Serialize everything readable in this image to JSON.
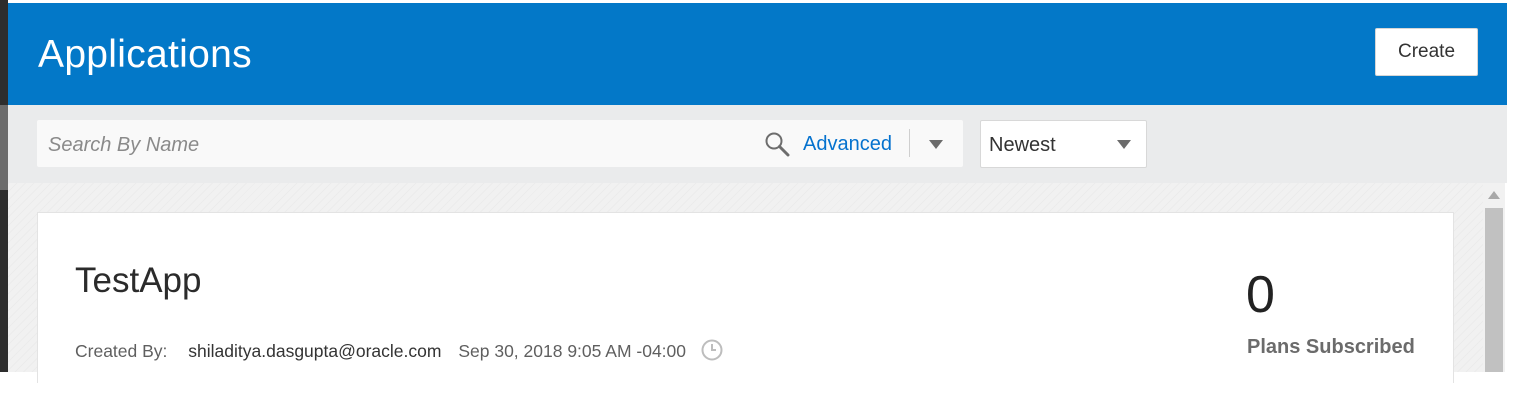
{
  "header": {
    "title": "Applications",
    "create_label": "Create"
  },
  "filter": {
    "search_placeholder": "Search By Name",
    "search_value": "",
    "advanced_label": "Advanced",
    "sort_selected": "Newest"
  },
  "applications": [
    {
      "name": "TestApp",
      "created_by_label": "Created By:",
      "created_by": "shiladitya.dasgupta@oracle.com",
      "created_at": "Sep 30, 2018 9:05 AM -04:00",
      "plans_count": "0",
      "plans_label": "Plans Subscribed"
    }
  ],
  "colors": {
    "header_bg": "#0378c8",
    "link": "#0572ce",
    "filter_bg": "#eaebec"
  },
  "icons": {
    "search": "search-icon",
    "clock": "clock-icon",
    "caret": "chevron-down-icon"
  }
}
